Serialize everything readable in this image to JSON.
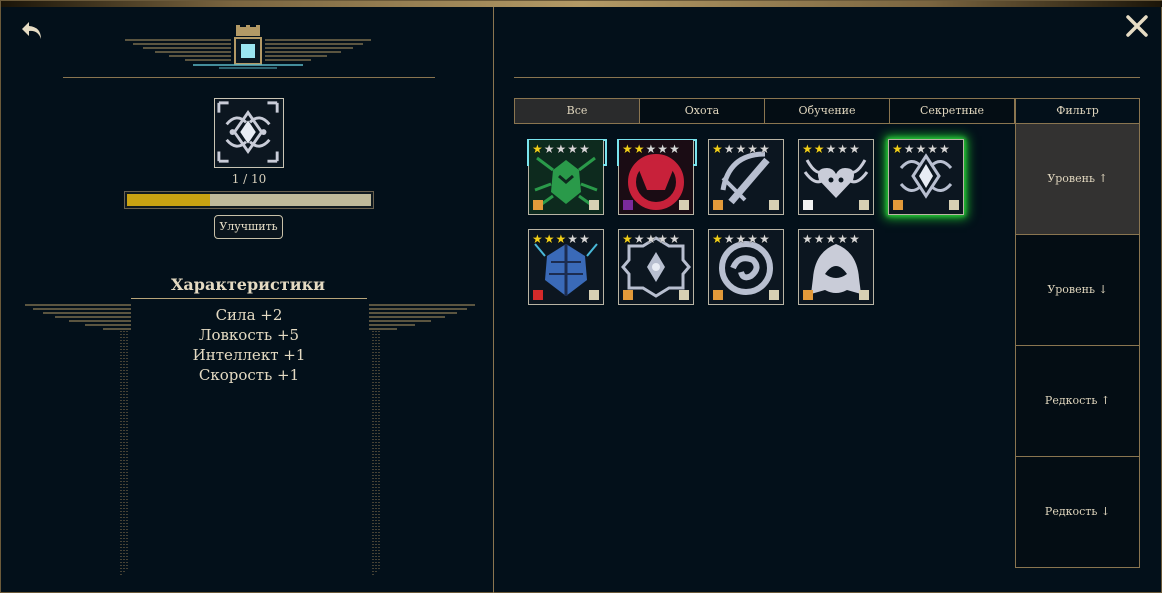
{
  "item": {
    "count_text": "1 / 10",
    "progress_fraction": 0.34,
    "upgrade_label": "Улучшить"
  },
  "stats": {
    "title": "Характеристики",
    "lines": [
      "Сила +2",
      "Ловкость +5",
      "Интеллект +1",
      "Скорость +1"
    ]
  },
  "tabs": [
    {
      "label": "Все",
      "active": true
    },
    {
      "label": "Охота",
      "active": false
    },
    {
      "label": "Обучение",
      "active": false
    },
    {
      "label": "Секретные",
      "active": false
    }
  ],
  "filter": {
    "header": "Фильтр",
    "options": [
      {
        "label": "Уровень ↑",
        "active": true
      },
      {
        "label": "Уровень ↓",
        "active": false
      },
      {
        "label": "Редкость ↑",
        "active": false
      },
      {
        "label": "Редкость ↓",
        "active": false
      }
    ]
  },
  "cards": [
    {
      "icon": "green-insect-emblem-icon",
      "stars": 1,
      "rarity_color": "#e39a3a",
      "highlight": "frame",
      "art_color": "#2a9a4a",
      "bg": "#0d2a1e"
    },
    {
      "icon": "red-moon-creature-icon",
      "stars": 2,
      "rarity_color": "#7a2a9a",
      "highlight": "frame",
      "art_color": "#c8213a",
      "bg": "#1a0c14"
    },
    {
      "icon": "sword-crescent-icon",
      "stars": 1,
      "rarity_color": "#e39a3a",
      "highlight": "none",
      "art_color": "#b8bfd0",
      "bg": "#0c1620"
    },
    {
      "icon": "winged-heart-icon",
      "stars": 2,
      "rarity_color": "#f2f2f2",
      "highlight": "none",
      "art_color": "#c9ccd8",
      "bg": "#0c1620"
    },
    {
      "icon": "bow-crest-icon",
      "stars": 1,
      "rarity_color": "#e39a3a",
      "highlight": "glow",
      "art_color": "#b8bfd0",
      "bg": "#0c1620"
    },
    {
      "icon": "blue-beetle-icon",
      "stars": 3,
      "rarity_color": "#d42a2a",
      "highlight": "none",
      "art_color": "#3a6ab8",
      "bg": "#0c1620"
    },
    {
      "icon": "ornate-seal-icon",
      "stars": 1,
      "rarity_color": "#e39a3a",
      "highlight": "none",
      "art_color": "#b8bfd0",
      "bg": "#0c1620"
    },
    {
      "icon": "serpent-ring-icon",
      "stars": 1,
      "rarity_color": "#e39a3a",
      "highlight": "none",
      "art_color": "#b8bfd0",
      "bg": "#0c1620"
    },
    {
      "icon": "hooded-figure-icon",
      "stars": 0,
      "rarity_color": "#e39a3a",
      "highlight": "none",
      "art_color": "#c9ccd8",
      "bg": "#0c1620"
    }
  ],
  "colors": {
    "gold": "#8a7550",
    "progress": "#c9a312",
    "star_on": "#f2d01a",
    "glow": "#1fbf2f",
    "select_frame": "#7ae4ee"
  }
}
